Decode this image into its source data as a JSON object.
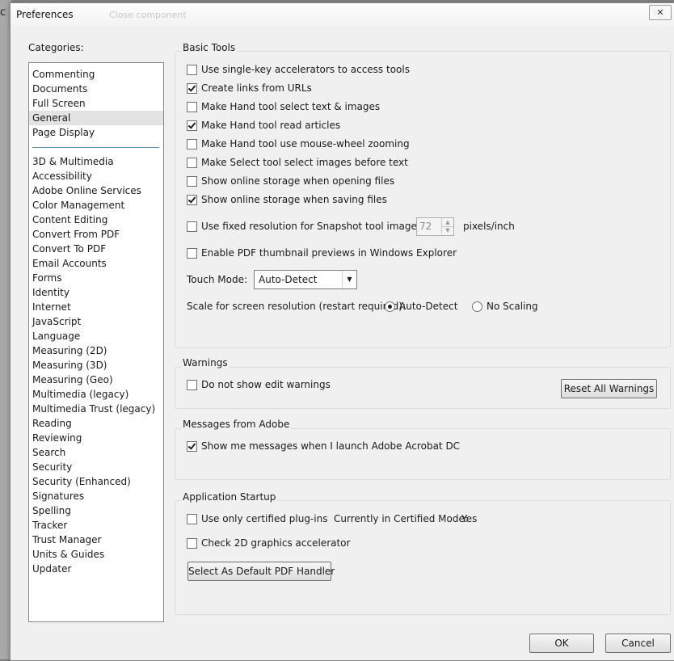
{
  "window": {
    "title": "Preferences",
    "close_glyph": "✕"
  },
  "background": {
    "left_char": "c",
    "ghost_text": "Close component"
  },
  "categories": {
    "label": "Categories:",
    "top_items": [
      "Commenting",
      "Documents",
      "Full Screen",
      "General",
      "Page Display"
    ],
    "selected": "General",
    "items": [
      "3D & Multimedia",
      "Accessibility",
      "Adobe Online Services",
      "Color Management",
      "Content Editing",
      "Convert From PDF",
      "Convert To PDF",
      "Email Accounts",
      "Forms",
      "Identity",
      "Internet",
      "JavaScript",
      "Language",
      "Measuring (2D)",
      "Measuring (3D)",
      "Measuring (Geo)",
      "Multimedia (legacy)",
      "Multimedia Trust (legacy)",
      "Reading",
      "Reviewing",
      "Search",
      "Security",
      "Security (Enhanced)",
      "Signatures",
      "Spelling",
      "Tracker",
      "Trust Manager",
      "Units & Guides",
      "Updater"
    ]
  },
  "basic_tools": {
    "title": "Basic Tools",
    "options": [
      {
        "label": "Use single-key accelerators to access tools",
        "checked": false
      },
      {
        "label": "Create links from URLs",
        "checked": true
      },
      {
        "label": "Make Hand tool select text & images",
        "checked": false
      },
      {
        "label": "Make Hand tool read articles",
        "checked": true
      },
      {
        "label": "Make Hand tool use mouse-wheel zooming",
        "checked": false
      },
      {
        "label": "Make Select tool select images before text",
        "checked": false
      },
      {
        "label": "Show online storage when opening files",
        "checked": false
      },
      {
        "label": "Show online storage when saving files",
        "checked": true
      }
    ],
    "snapshot": {
      "label": "Use fixed resolution for Snapshot tool images:",
      "checked": false,
      "value": "72",
      "unit": "pixels/inch"
    },
    "thumbnail": {
      "label": "Enable PDF thumbnail previews in Windows Explorer",
      "checked": false
    },
    "touch_mode": {
      "label": "Touch Mode:",
      "value": "Auto-Detect"
    },
    "scale": {
      "label": "Scale for screen resolution (restart required):",
      "options": [
        "Auto-Detect",
        "No Scaling"
      ],
      "selected": "Auto-Detect"
    }
  },
  "warnings": {
    "title": "Warnings",
    "option": {
      "label": "Do not show edit warnings",
      "checked": false
    },
    "reset_button": "Reset All Warnings"
  },
  "messages": {
    "title": "Messages from Adobe",
    "option": {
      "label": "Show me messages when I launch Adobe Acrobat DC",
      "checked": true
    }
  },
  "startup": {
    "title": "Application Startup",
    "certified": {
      "label": "Use only certified plug-ins",
      "checked": false
    },
    "certified_mode_label": "Currently in Certified Mode:",
    "certified_mode_value": "Yes",
    "graphics": {
      "label": "Check 2D graphics accelerator",
      "checked": false
    },
    "default_handler_button": "Select As Default PDF Handler"
  },
  "footer": {
    "ok": "OK",
    "cancel": "Cancel"
  }
}
